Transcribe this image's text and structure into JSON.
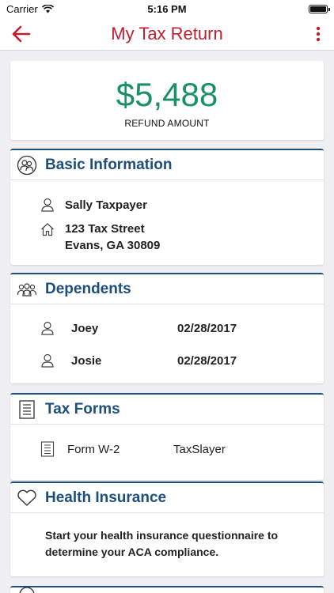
{
  "status_bar": {
    "carrier": "Carrier",
    "time": "5:16 PM"
  },
  "nav": {
    "title": "My Tax Return"
  },
  "refund": {
    "amount": "$5,488",
    "label": "REFUND AMOUNT"
  },
  "basic": {
    "title": "Basic Information",
    "name": "Sally Taxpayer",
    "address_line1": "123 Tax Street",
    "address_line2": "Evans, GA 30809"
  },
  "dependents": {
    "title": "Dependents",
    "items": [
      {
        "name": "Joey",
        "dob": "02/28/2017"
      },
      {
        "name": "Josie",
        "dob": "02/28/2017"
      }
    ]
  },
  "tax_forms": {
    "title": "Tax Forms",
    "items": [
      {
        "form": "Form W-2",
        "source": "TaxSlayer"
      }
    ]
  },
  "health": {
    "title": "Health Insurance",
    "text": "Start your health insurance questionnaire to determine your ACA compliance."
  },
  "colors": {
    "brand_red": "#c01e2e",
    "header_blue": "#1d4f7c",
    "refund_green": "#1a9162"
  },
  "icons": {
    "back": "arrow-left-icon",
    "more": "vertical-dots-icon",
    "basic": "people-circle-icon",
    "person": "person-icon",
    "home": "home-icon",
    "dependents": "group-icon",
    "forms": "document-icon",
    "health": "heart-icon"
  }
}
